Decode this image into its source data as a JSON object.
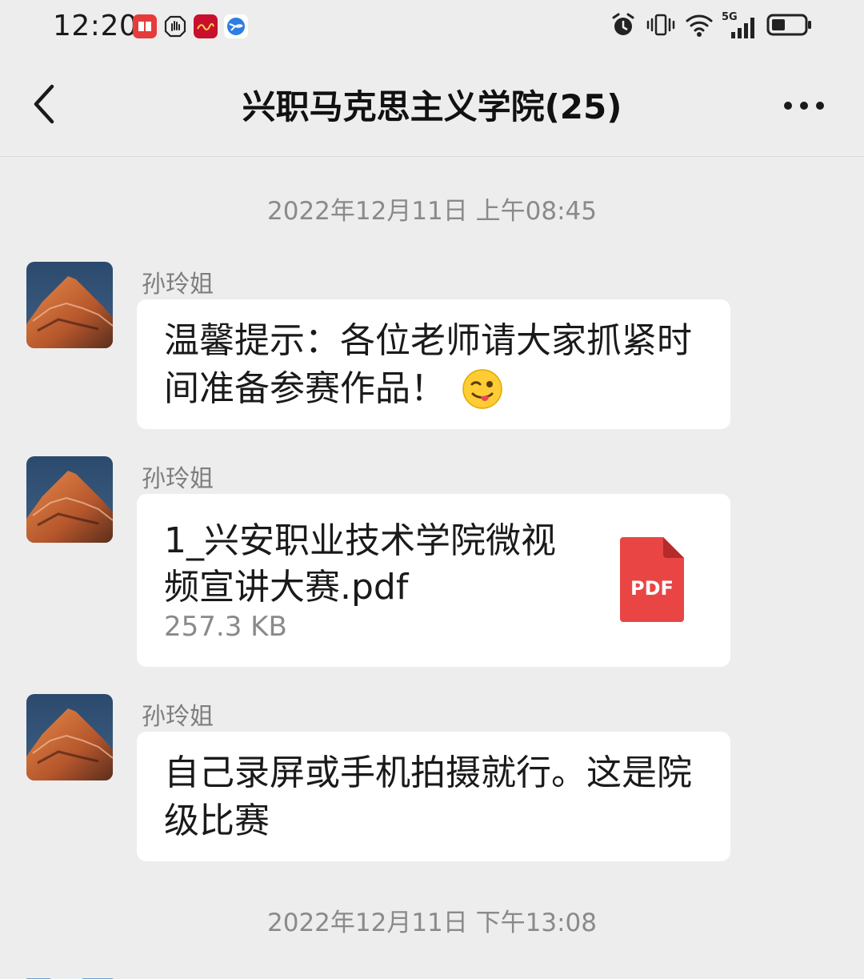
{
  "status_bar": {
    "time": "12:20",
    "network": "5G"
  },
  "header": {
    "title": "兴职马克思主义学院(25)"
  },
  "timestamps": {
    "first": "2022年12月11日 上午08:45",
    "second": "2022年12月11日 下午13:08"
  },
  "messages": [
    {
      "sender": "孙玲姐",
      "text_line1": "温馨提示：各位老师请大家抓紧时",
      "text_line2": "间准备参赛作品！",
      "emoji": "wink-tongue-emoji"
    },
    {
      "sender": "孙玲姐",
      "file_name_line1": "1_兴安职业技术学院微视",
      "file_name_line2": "频宣讲大赛.pdf",
      "file_size": "257.3 KB",
      "file_icon_label": "PDF"
    },
    {
      "sender": "孙玲姐",
      "text_line1": "自己录屏或手机拍摄就行。这是院",
      "text_line2": "级比赛"
    }
  ],
  "colors": {
    "background": "#ededed",
    "bubble": "#ffffff",
    "pdf_red": "#e94545",
    "muted_text": "#8a8a8a"
  }
}
